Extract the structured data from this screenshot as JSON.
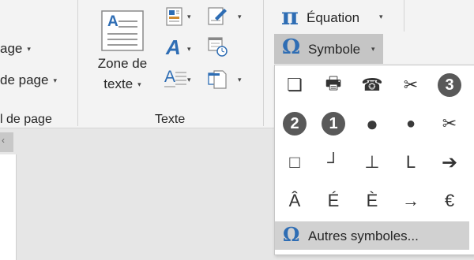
{
  "ribbon": {
    "left_group": {
      "item1_label": "age",
      "item2_label": "de page",
      "group_label": "l de page"
    },
    "texte_group": {
      "zone_line1": "Zone de",
      "zone_line2": "texte",
      "group_label": "Texte",
      "zone_icon_letter": "A",
      "wordart_letter": "A",
      "dropcap_letter": "A"
    },
    "symbols_group": {
      "equation_label": "Équation",
      "equation_glyph": "π",
      "symbole_label": "Symbole",
      "symbole_glyph": "Ω"
    }
  },
  "symbol_gallery": {
    "symbols": [
      "❏",
      "🖶",
      "☎",
      "✂",
      "3",
      "2",
      "1",
      "●",
      "●",
      "✂",
      "□",
      "┘",
      "⊥",
      "L",
      "➔",
      "Â",
      "É",
      "È",
      "→",
      "€"
    ],
    "more_label": "Autres symboles...",
    "more_glyph": "Ω"
  },
  "scroll_tab_glyph": "‹",
  "colors": {
    "accent_blue": "#2e6db4",
    "selected_bg": "#c5c5c5",
    "dark_circle": "#595959"
  }
}
